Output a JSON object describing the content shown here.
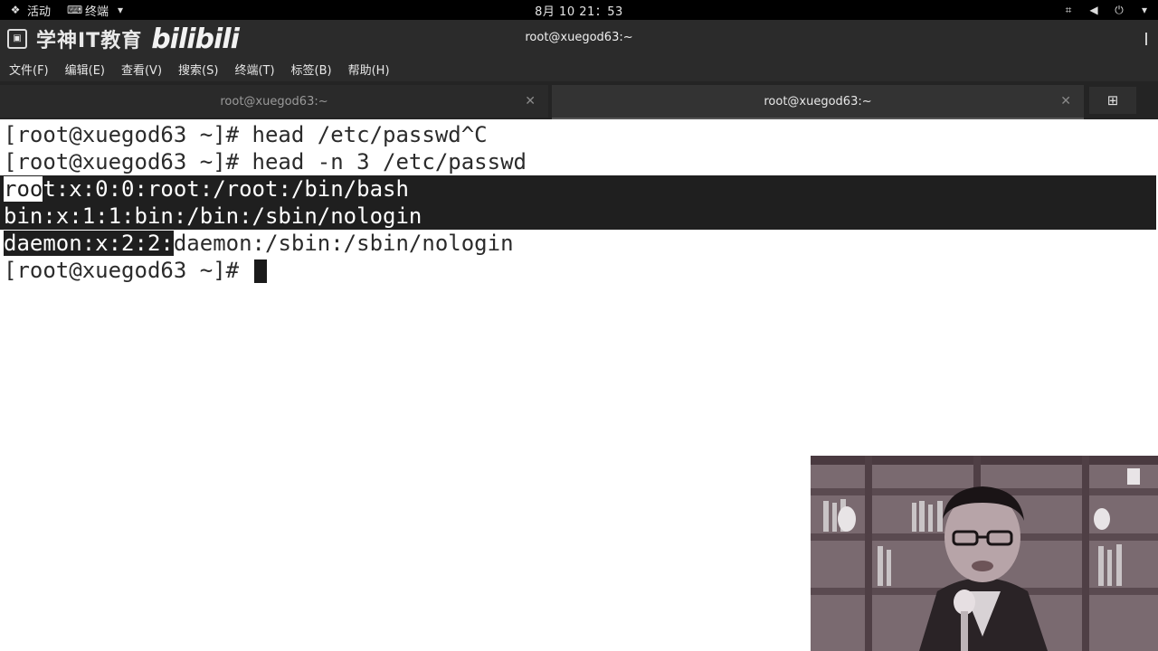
{
  "topbar": {
    "activities": "活动",
    "app_menu": "终端",
    "clock": "8月 10  21：53"
  },
  "window": {
    "title": "root@xuegod63:~",
    "watermark_brand": "学神IT教育",
    "watermark_logo": "bilibili"
  },
  "menubar": {
    "items": [
      "文件(F)",
      "编辑(E)",
      "查看(V)",
      "搜索(S)",
      "终端(T)",
      "标签(B)",
      "帮助(H)"
    ]
  },
  "tabs": [
    {
      "label": "root@xuegod63:~",
      "active": false
    },
    {
      "label": "root@xuegod63:~",
      "active": true
    }
  ],
  "terminal": {
    "line1": "[root@xuegod63 ~]# head /etc/passwd^C",
    "line2": "[root@xuegod63 ~]# head -n 3 /etc/passwd",
    "line3_a": "roo",
    "line3_b": "t:x:0:0:root:/root:/bin/bash",
    "line4": "bin:x:1:1:bin:/bin:/sbin/nologin",
    "line5_a": "daemon:x:2:2:",
    "line5_b": "daemon:/sbin:/sbin/nologin",
    "line6": "[root@xuegod63 ~]# "
  },
  "colors": {
    "topbar_bg": "#000000",
    "titlebar_bg": "#2b2b2b",
    "terminal_bg": "#ffffff",
    "terminal_fg": "#2b2b2b",
    "selection_bg": "#1f1f1f"
  },
  "icons": [
    "activities-icon",
    "terminal-app-icon",
    "chevron-down-icon",
    "network-icon",
    "volume-icon",
    "power-icon",
    "close-icon",
    "new-tab-icon"
  ]
}
